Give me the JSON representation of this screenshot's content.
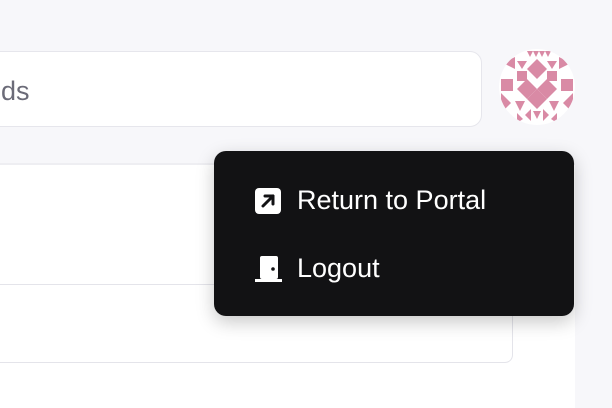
{
  "search": {
    "visible_text": "ds"
  },
  "avatar": {
    "color": "#d98aa5",
    "icon": "identicon-avatar"
  },
  "user_menu": {
    "items": [
      {
        "label": "Return to Portal",
        "icon": "external-link-icon"
      },
      {
        "label": "Logout",
        "icon": "door-icon"
      }
    ]
  },
  "colors": {
    "menu_background": "#121214",
    "menu_text": "#ffffff",
    "page_background": "#f7f7fa"
  }
}
